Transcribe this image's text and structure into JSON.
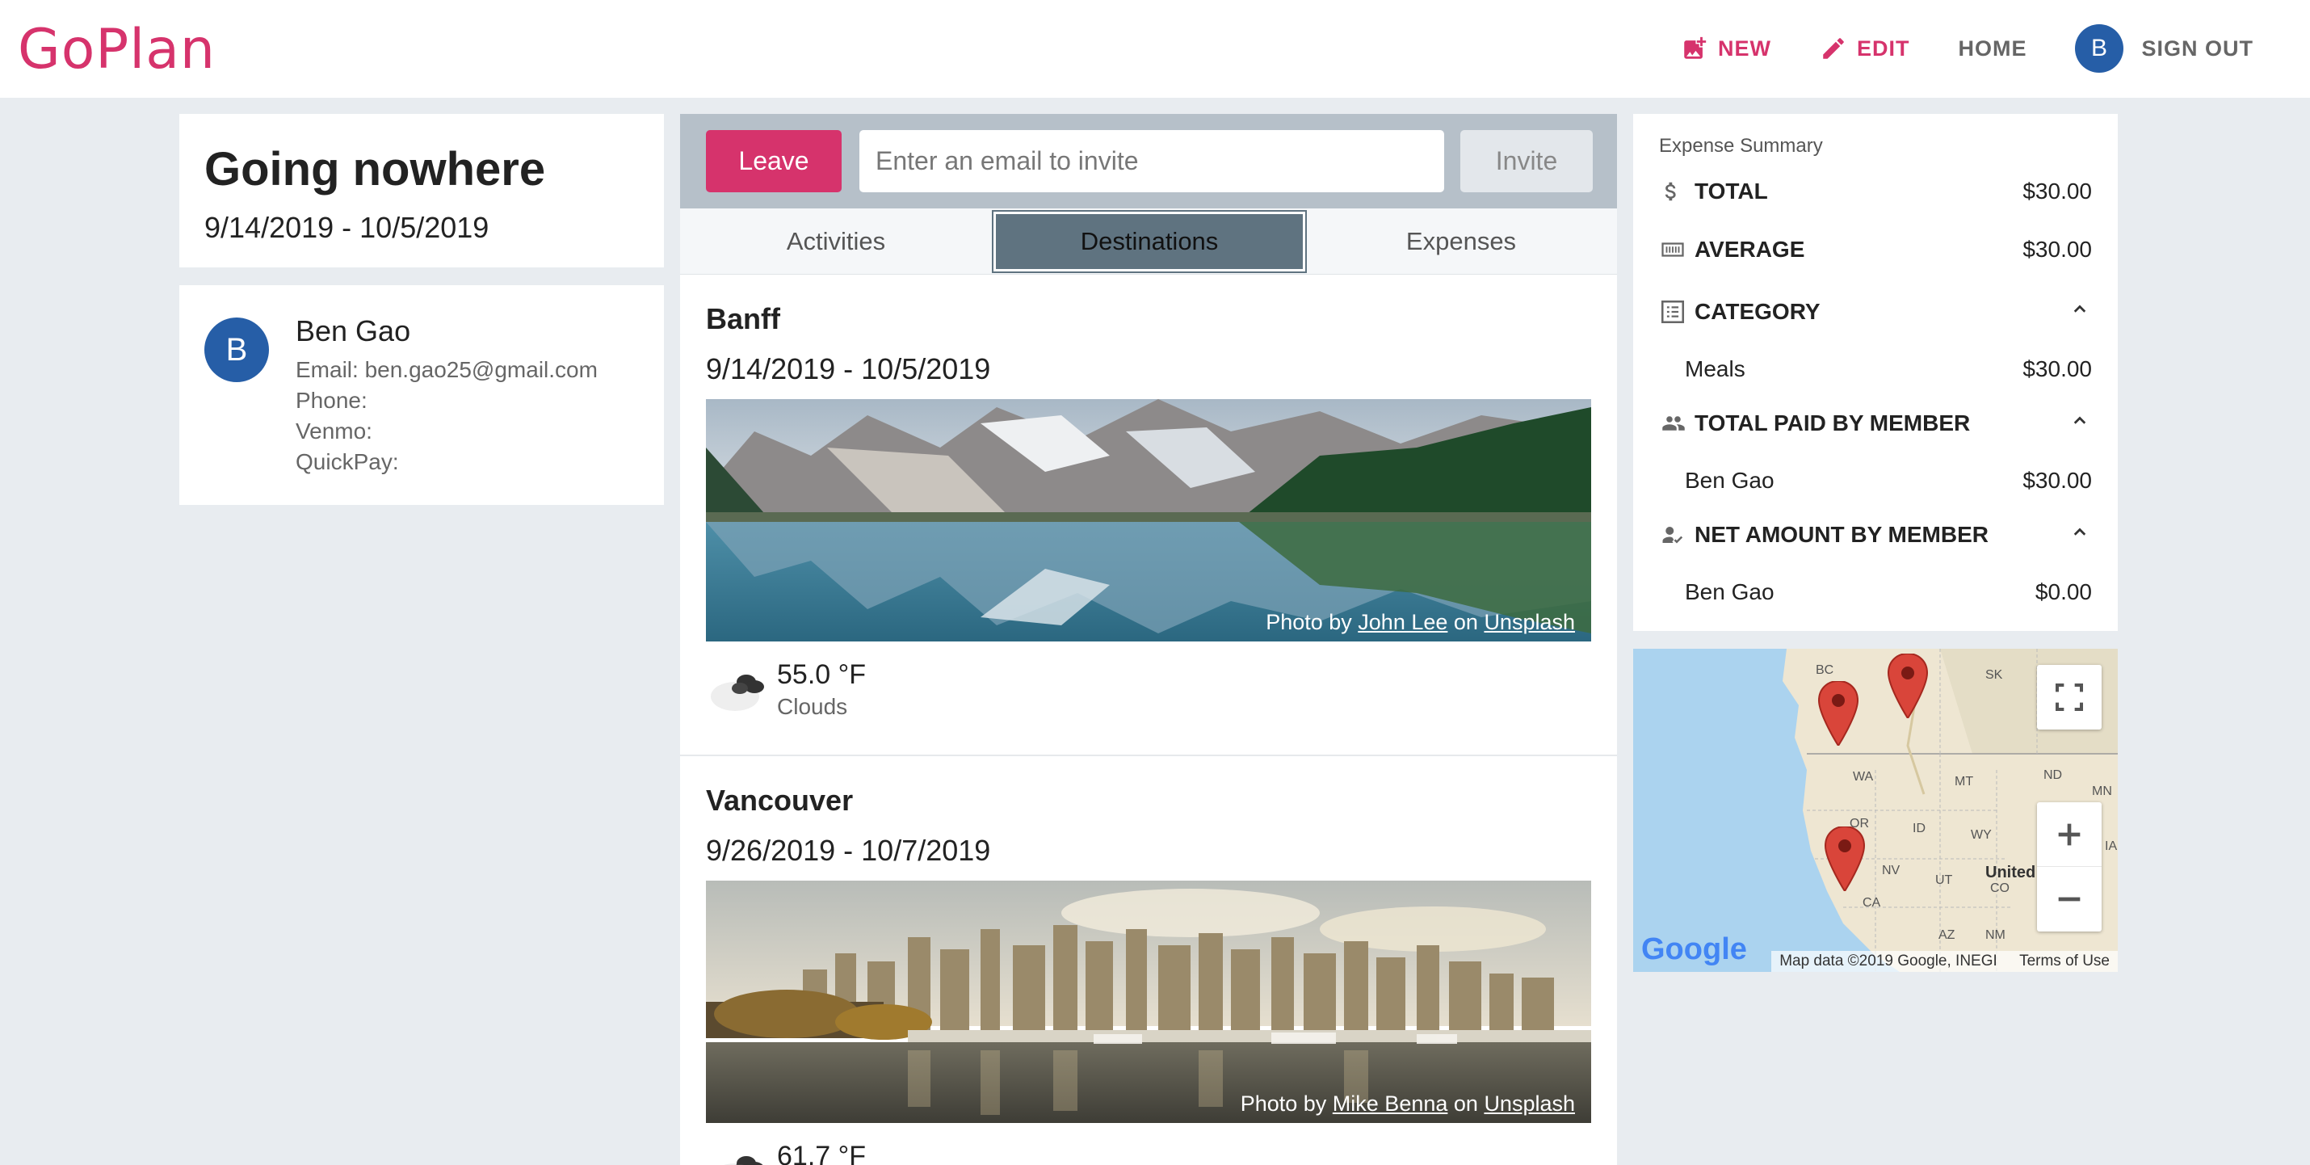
{
  "header": {
    "logo": "GoPlan",
    "nav": {
      "new_label": "NEW",
      "edit_label": "EDIT",
      "home_label": "HOME",
      "avatar_initial": "B",
      "signout_label": "SIGN OUT"
    }
  },
  "trip": {
    "title": "Going nowhere",
    "dates": "9/14/2019 - 10/5/2019"
  },
  "member": {
    "initial": "B",
    "name": "Ben Gao",
    "email": "Email: ben.gao25@gmail.com",
    "phone": "Phone:",
    "venmo": "Venmo:",
    "quickpay": "QuickPay:"
  },
  "invite": {
    "leave_label": "Leave",
    "placeholder": "Enter an email to invite",
    "invite_label": "Invite"
  },
  "tabs": {
    "activities": "Activities",
    "destinations": "Destinations",
    "expenses": "Expenses",
    "active": "Destinations"
  },
  "destinations": [
    {
      "name": "Banff",
      "dates": "9/14/2019 - 10/5/2019",
      "credit_prefix": "Photo by ",
      "credit_author": "John Lee",
      "credit_mid": " on ",
      "credit_site": "Unsplash",
      "temp": "55.0 °F",
      "condition": "Clouds"
    },
    {
      "name": "Vancouver",
      "dates": "9/26/2019 - 10/7/2019",
      "credit_prefix": "Photo by ",
      "credit_author": "Mike Benna",
      "credit_mid": " on ",
      "credit_site": "Unsplash",
      "temp": "61.7 °F",
      "condition": ""
    }
  ],
  "expense_summary": {
    "heading": "Expense Summary",
    "total_label": "TOTAL",
    "total_value": "$30.00",
    "average_label": "AVERAGE",
    "average_value": "$30.00",
    "category_label": "CATEGORY",
    "category_items": [
      {
        "name": "Meals",
        "value": "$30.00"
      }
    ],
    "paid_label": "TOTAL PAID BY MEMBER",
    "paid_items": [
      {
        "name": "Ben Gao",
        "value": "$30.00"
      }
    ],
    "net_label": "NET AMOUNT BY MEMBER",
    "net_items": [
      {
        "name": "Ben Gao",
        "value": "$0.00"
      }
    ]
  },
  "map": {
    "labels": [
      "BC",
      "SK",
      "WA",
      "MT",
      "ND",
      "MN",
      "OR",
      "ID",
      "WY",
      "NV",
      "UT",
      "CO",
      "CA",
      "AZ",
      "NM",
      "IA"
    ],
    "country_label": "United",
    "google": "Google",
    "map_data": "Map data ©2019 Google, INEGI",
    "terms": "Terms of Use"
  },
  "colors": {
    "brand": "#d6336c",
    "avatar": "#265ea7",
    "active_tab": "#5f7380"
  }
}
